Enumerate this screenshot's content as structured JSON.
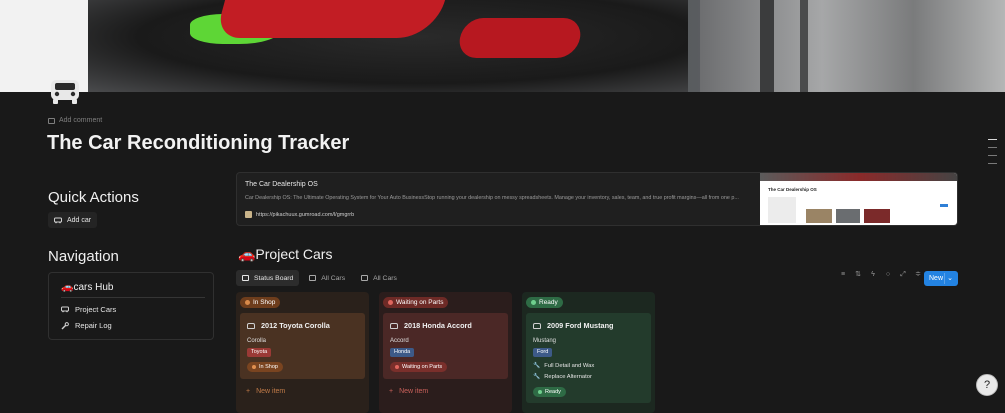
{
  "page": {
    "title": "The Car Reconditioning Tracker",
    "add_comment": "Add comment",
    "icon": "car-icon"
  },
  "quick_actions": {
    "heading": "Quick Actions",
    "add_car_label": "Add car",
    "add_car_icon": "car-icon"
  },
  "bookmark": {
    "title": "The Car Dealership OS",
    "description": "Car Dealership OS: The Ultimate Operating System for Your Auto BusinessStop running your dealership on messy spreadsheets. Manage your inventory, sales, team, and true profit margins—all from one p...",
    "url": "https://pikachuux.gumroad.com/l/gmgrrb",
    "thumb_title": "The Car Dealership OS"
  },
  "navigation": {
    "heading": "Navigation",
    "hub": "🚗cars Hub",
    "items": [
      {
        "label": "Project Cars",
        "icon": "car-icon"
      },
      {
        "label": "Repair Log",
        "icon": "wrench-icon"
      }
    ]
  },
  "database": {
    "title": "🚗Project Cars",
    "tabs": [
      {
        "label": "Status Board",
        "icon": "board-icon",
        "active": true
      },
      {
        "label": "All Cars",
        "icon": "table-icon",
        "active": false
      },
      {
        "label": "All Cars",
        "icon": "gallery-icon",
        "active": false
      }
    ],
    "new_label": "New",
    "new_item_label": "New item",
    "columns": [
      {
        "status": "In Shop",
        "color": "#8a4a1e",
        "card": {
          "title": "2012 Toyota Corolla",
          "model": "Corolla",
          "make": "Toyota",
          "status": "In Shop",
          "tasks": []
        }
      },
      {
        "status": "Waiting on Parts",
        "color": "#8a2f2a",
        "card": {
          "title": "2018 Honda Accord",
          "model": "Accord",
          "make": "Honda",
          "status": "Waiting on Parts",
          "tasks": []
        }
      },
      {
        "status": "Ready",
        "color": "#2e6b45",
        "card": {
          "title": "2009 Ford Mustang",
          "model": "Mustang",
          "make": "Ford",
          "status": "Ready",
          "tasks": [
            "Full Detail and Wax",
            "Replace Alternator"
          ]
        }
      }
    ]
  },
  "colors": {
    "accent": "#2383e2",
    "background": "#191919"
  }
}
